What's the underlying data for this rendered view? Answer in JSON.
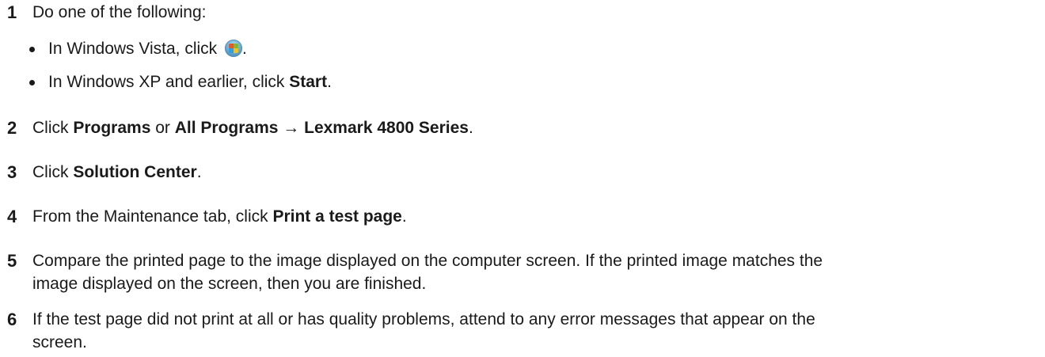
{
  "steps": [
    {
      "number": "1",
      "text": "Do one of the following:",
      "bullets": [
        {
          "before": "In Windows Vista, click ",
          "after": "."
        },
        {
          "before": "In Windows XP and earlier, click ",
          "bold": "Start",
          "after": "."
        }
      ]
    },
    {
      "number": "2",
      "t1": "Click ",
      "b1": "Programs",
      "t2": " or ",
      "b2": "All Programs → Lexmark 4800 Series",
      "t3": "."
    },
    {
      "number": "3",
      "t1": "Click ",
      "b1": "Solution Center",
      "t2": "."
    },
    {
      "number": "4",
      "t1": "From the Maintenance tab, click ",
      "b1": "Print a test page",
      "t2": "."
    },
    {
      "number": "5",
      "line1": "Compare the printed page to the image displayed on the computer screen. If the printed image matches the",
      "line2": "image displayed on the screen, then you are finished."
    },
    {
      "number": "6",
      "line1": "If the test page did not print at all or has quality problems, attend to any error messages that appear on the",
      "line2": "screen."
    }
  ],
  "icons": {
    "vista_start": "windows-vista-start-orb-icon"
  }
}
